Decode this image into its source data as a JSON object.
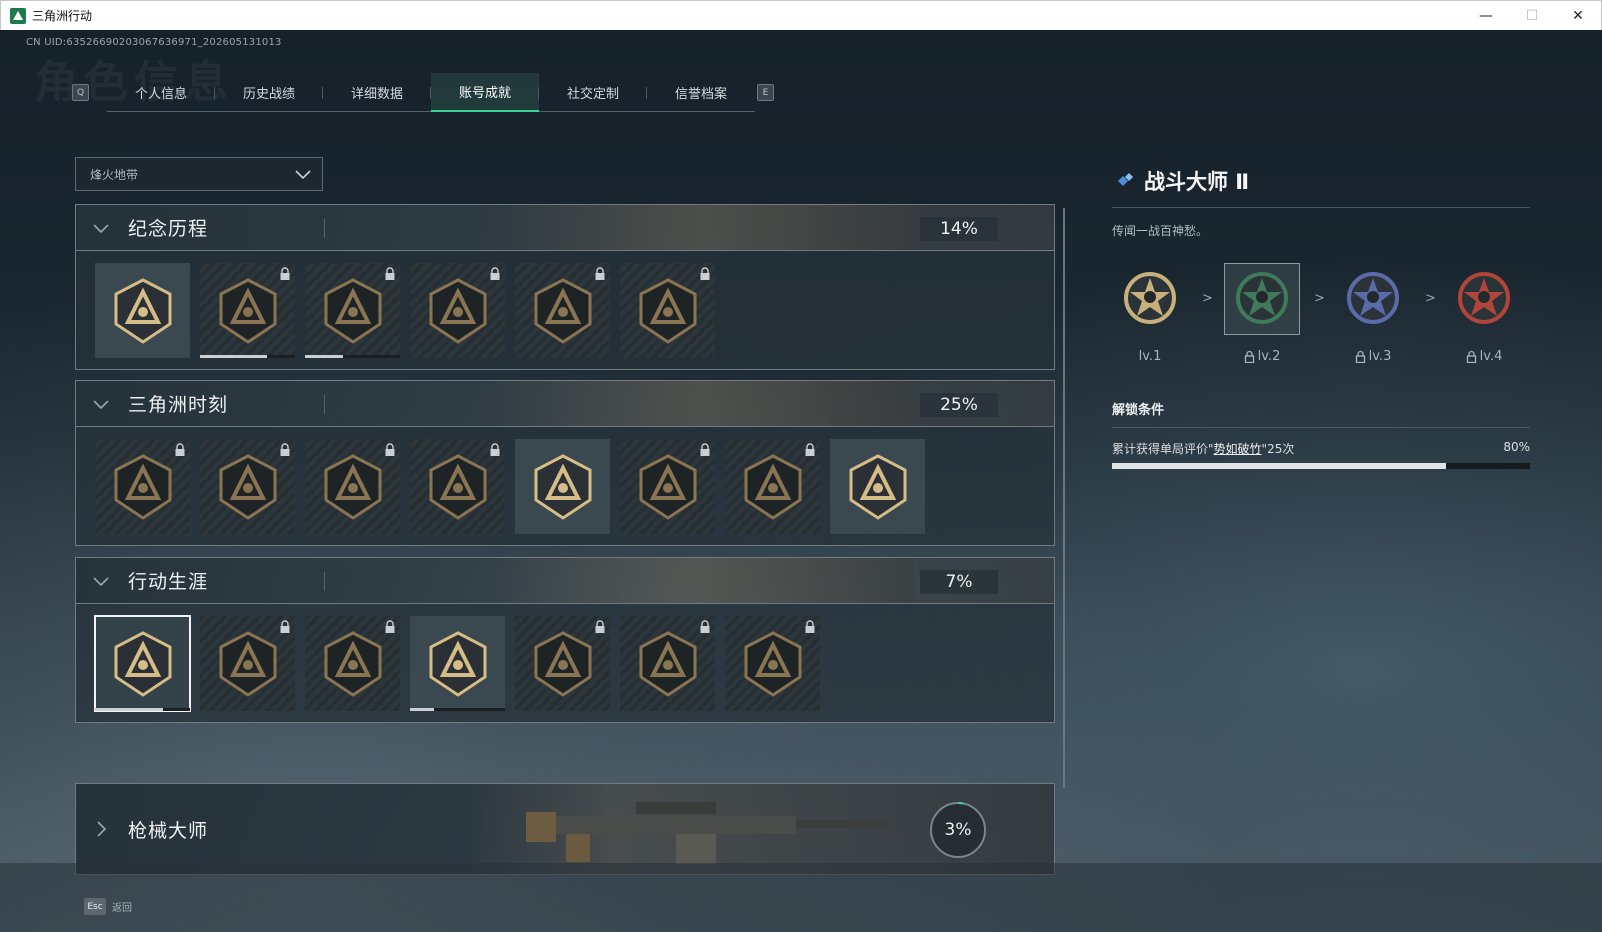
{
  "window": {
    "title": "三角洲行动",
    "min_glyph": "—",
    "max_glyph": "☐",
    "close_glyph": "✕"
  },
  "uid_text": "CN UID:63526690203067636971_202605131013",
  "watermark": "角色信息",
  "tab_keys": {
    "left": "Q",
    "right": "E"
  },
  "tabs": [
    {
      "label": "个人信息",
      "active": false
    },
    {
      "label": "历史战绩",
      "active": false
    },
    {
      "label": "详细数据",
      "active": false
    },
    {
      "label": "账号成就",
      "active": true
    },
    {
      "label": "社交定制",
      "active": false
    },
    {
      "label": "信誉档案",
      "active": false
    }
  ],
  "mode_select": {
    "value": "烽火地带"
  },
  "sections": [
    {
      "title": "纪念历程",
      "percent": "14%",
      "badges": [
        {
          "icon": "triangle-shield-emblem-icon",
          "locked": false,
          "unlocked_style": true
        },
        {
          "icon": "helicopter-emblem-icon",
          "locked": true,
          "progress": 0.7
        },
        {
          "icon": "armored-shield-emblem-icon",
          "locked": true,
          "progress": 0.4
        },
        {
          "icon": "operator-crest-emblem-icon",
          "locked": true
        },
        {
          "icon": "hooded-figure-emblem-icon",
          "locked": true
        },
        {
          "icon": "crossed-blades-emblem-icon",
          "locked": true
        }
      ]
    },
    {
      "title": "三角洲时刻",
      "percent": "25%",
      "badges": [
        {
          "icon": "supply-box-emblem-icon",
          "locked": true
        },
        {
          "icon": "soldier-bust-emblem-icon",
          "locked": true
        },
        {
          "icon": "kneeling-soldier-emblem-icon",
          "locked": true
        },
        {
          "icon": "globe-hands-emblem-icon",
          "locked": true
        },
        {
          "icon": "squad-emblem-icon",
          "locked": false,
          "unlocked_style": true
        },
        {
          "icon": "winged-squad-emblem-icon",
          "locked": true
        },
        {
          "icon": "fish-emblem-icon",
          "locked": true
        },
        {
          "icon": "rose-diamond-emblem-icon",
          "locked": false,
          "unlocked_style": true
        }
      ]
    },
    {
      "title": "行动生涯",
      "percent": "7%",
      "badges": [
        {
          "icon": "star-skull-emblem-icon",
          "locked": false,
          "selected": true,
          "progress": 0.72
        },
        {
          "icon": "wing-chevron-emblem-icon",
          "locked": true
        },
        {
          "icon": "dagger-shield-emblem-icon",
          "locked": true
        },
        {
          "icon": "gem-shield-emblem-icon",
          "locked": false,
          "unlocked_style": true,
          "progress": 0.25
        },
        {
          "icon": "ring-emblem-icon",
          "locked": true
        },
        {
          "icon": "crosshair-skull-emblem-icon",
          "locked": true
        },
        {
          "icon": "eye-emblem-icon",
          "locked": true
        }
      ]
    }
  ],
  "gun_section": {
    "title": "枪械大师",
    "percent": "3%",
    "progress": 0.03
  },
  "detail": {
    "title": "战斗大师 Ⅱ",
    "description": "传闻一战百神愁。",
    "levels": [
      {
        "label": "lv.1",
        "locked": false,
        "color": "#c8b07a"
      },
      {
        "label": "lv.2",
        "locked": true,
        "selected": true,
        "color": "#3f7a5a"
      },
      {
        "label": "lv.3",
        "locked": true,
        "color": "#5b6aa8"
      },
      {
        "label": "lv.4",
        "locked": true,
        "color": "#b0453a"
      }
    ],
    "arrow_glyph": ">",
    "unlock_title": "解锁条件",
    "condition": {
      "prefix": "累计获得单局评价\"",
      "highlight": "势如破竹",
      "suffix": "\"25次",
      "percent": "80%",
      "progress": 0.8
    }
  },
  "footer": {
    "key": "Esc",
    "label": "返回"
  },
  "colors": {
    "accent": "#3fd39c",
    "emblem_gold": "#c8ad78",
    "text": "#d8dde2"
  }
}
